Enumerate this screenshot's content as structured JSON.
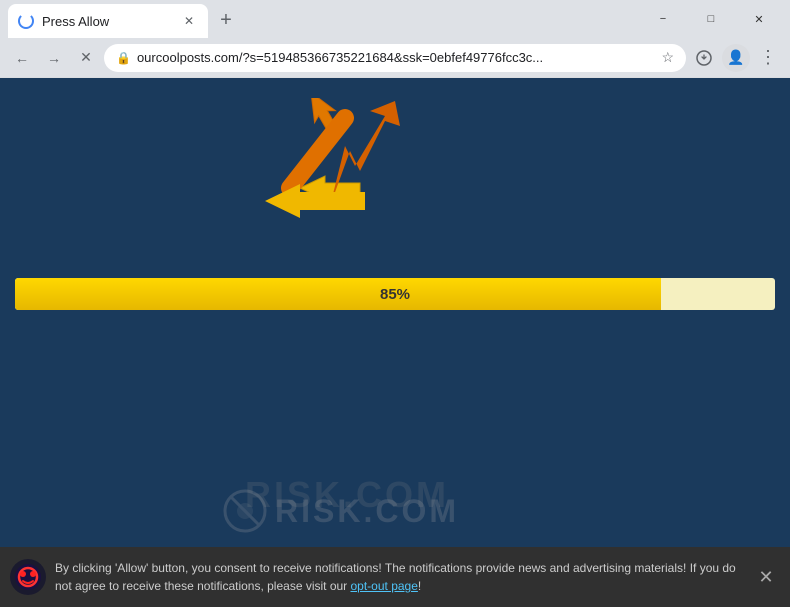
{
  "window": {
    "title": "Press Allow",
    "minimize_label": "−",
    "maximize_label": "□",
    "close_label": "✕"
  },
  "tabs": [
    {
      "title": "Press Allow",
      "active": true
    }
  ],
  "new_tab_icon": "+",
  "address_bar": {
    "url": "ourcoolposts.com/?s=519485366735221684&ssk=0ebfef49776fcc3c...",
    "lock_icon": "🔒"
  },
  "nav": {
    "back_icon": "←",
    "forward_icon": "→",
    "reload_icon": "✕"
  },
  "page": {
    "background_color": "#1a3a5c",
    "progress_value": 85,
    "progress_label": "85%"
  },
  "notification_banner": {
    "text_before_link": "By clicking 'Allow' button, you consent to receive notifications! The notifications provide news and advertising materials! If you do not agree to receive these notifications, please visit our ",
    "link_text": "opt-out page",
    "text_after_link": "!",
    "close_icon": "✕"
  },
  "watermark": {
    "text": "RISK.COM"
  }
}
